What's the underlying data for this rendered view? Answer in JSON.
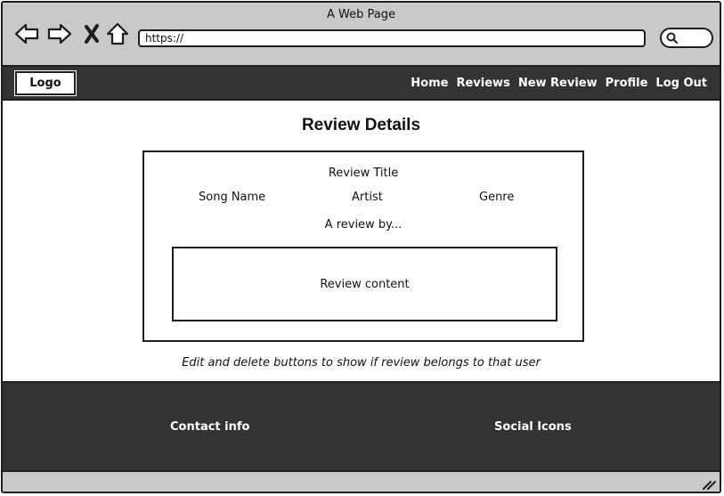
{
  "window": {
    "title": "A Web Page"
  },
  "browser": {
    "url": "https://",
    "icons": [
      "back-arrow-icon",
      "forward-arrow-icon",
      "close-icon",
      "home-icon",
      "search-icon",
      "resize-grip-icon"
    ]
  },
  "navbar": {
    "logo": "Logo",
    "links": [
      "Home",
      "Reviews",
      "New Review",
      "Profile",
      "Log Out"
    ]
  },
  "main": {
    "title": "Review Details",
    "card": {
      "review_title": "Review Title",
      "song_name": "Song Name",
      "artist": "Artist",
      "genre": "Genre",
      "byline": "A review by...",
      "content": "Review content"
    },
    "note": "Edit and delete buttons to show if review belongs to that user"
  },
  "footer": {
    "contact": "Contact info",
    "social": "Social Icons"
  },
  "colors": {
    "chrome": "#c9c9c9",
    "dark_bar": "#333333",
    "outline": "#1e1e1e"
  }
}
